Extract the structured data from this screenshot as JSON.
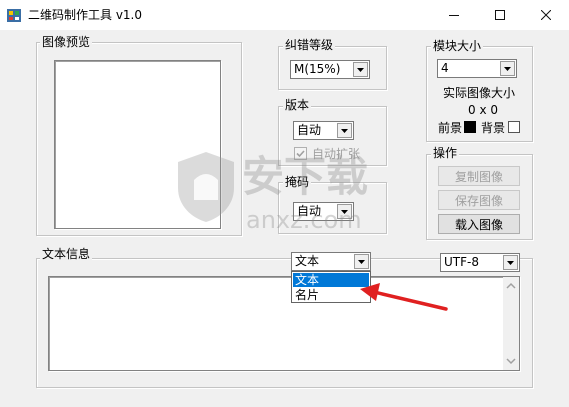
{
  "window": {
    "title": "二维码制作工具 v1.0",
    "min_glyph": "—",
    "max_glyph": "☐",
    "close_glyph": "✕"
  },
  "preview": {
    "label": "图像预览"
  },
  "error_level": {
    "label": "纠错等级",
    "value": "M(15%)"
  },
  "version": {
    "label": "版本",
    "value": "自动",
    "auto_expand_label": "自动扩张",
    "auto_expand_checked": true
  },
  "mask": {
    "label": "掩码",
    "value": "自动"
  },
  "module_size": {
    "label": "模块大小",
    "value": "4",
    "actual_size_label": "实际图像大小",
    "actual_size_value": "0 x 0",
    "foreground_label": "前景",
    "background_label": "背景",
    "foreground_color": "#000000",
    "background_color": "#ffffff"
  },
  "operations": {
    "label": "操作",
    "copy_label": "复制图像",
    "save_label": "保存图像",
    "load_label": "载入图像"
  },
  "text_info": {
    "label": "文本信息",
    "type_value": "文本",
    "type_options": [
      "文本",
      "名片"
    ],
    "selected_option": "文本",
    "encoding_value": "UTF-8",
    "content": ""
  },
  "watermark": {
    "text": "安下载",
    "subtext": "anxz.com"
  },
  "colors": {
    "selection": "#0078d7",
    "annotation_arrow": "#e02020"
  }
}
